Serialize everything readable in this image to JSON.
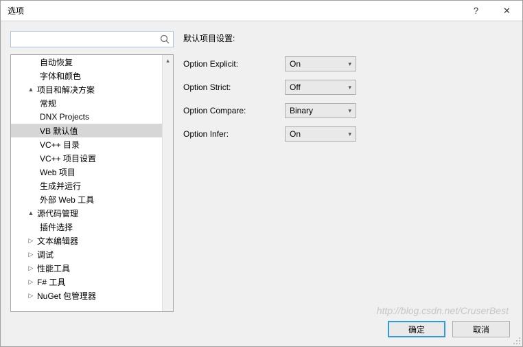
{
  "window": {
    "title": "选项",
    "help": "?",
    "close": "✕"
  },
  "search": {
    "placeholder": ""
  },
  "tree": [
    {
      "label": "自动恢复",
      "indent": 2,
      "exp": "",
      "selected": false
    },
    {
      "label": "字体和颜色",
      "indent": 2,
      "exp": "",
      "selected": false
    },
    {
      "label": "项目和解决方案",
      "indent": 1,
      "exp": "▲",
      "selected": false
    },
    {
      "label": "常规",
      "indent": 2,
      "exp": "",
      "selected": false
    },
    {
      "label": "DNX Projects",
      "indent": 2,
      "exp": "",
      "selected": false
    },
    {
      "label": "VB 默认值",
      "indent": 2,
      "exp": "",
      "selected": true
    },
    {
      "label": "VC++ 目录",
      "indent": 2,
      "exp": "",
      "selected": false
    },
    {
      "label": "VC++ 项目设置",
      "indent": 2,
      "exp": "",
      "selected": false
    },
    {
      "label": "Web 项目",
      "indent": 2,
      "exp": "",
      "selected": false
    },
    {
      "label": "生成并运行",
      "indent": 2,
      "exp": "",
      "selected": false
    },
    {
      "label": "外部 Web 工具",
      "indent": 2,
      "exp": "",
      "selected": false
    },
    {
      "label": "源代码管理",
      "indent": 1,
      "exp": "▲",
      "selected": false
    },
    {
      "label": "插件选择",
      "indent": 2,
      "exp": "",
      "selected": false
    },
    {
      "label": "文本编辑器",
      "indent": 1,
      "exp": "▷",
      "selected": false
    },
    {
      "label": "调试",
      "indent": 1,
      "exp": "▷",
      "selected": false
    },
    {
      "label": "性能工具",
      "indent": 1,
      "exp": "▷",
      "selected": false
    },
    {
      "label": "F# 工具",
      "indent": 1,
      "exp": "▷",
      "selected": false
    },
    {
      "label": "NuGet 包管理器",
      "indent": 1,
      "exp": "▷",
      "selected": false
    }
  ],
  "settings": {
    "heading": "默认项目设置:",
    "rows": [
      {
        "label": "Option Explicit:",
        "value": "On"
      },
      {
        "label": "Option Strict:",
        "value": "Off"
      },
      {
        "label": "Option Compare:",
        "value": "Binary"
      },
      {
        "label": "Option Infer:",
        "value": "On"
      }
    ]
  },
  "buttons": {
    "ok": "确定",
    "cancel": "取消"
  },
  "watermark": "http://blog.csdn.net/CruserBest"
}
